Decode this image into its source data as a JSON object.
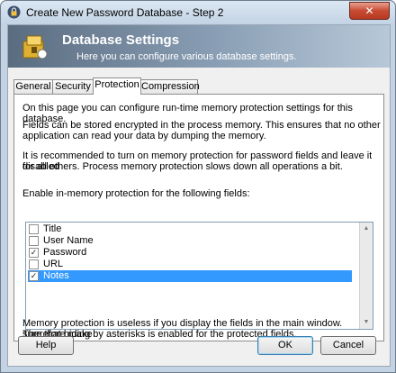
{
  "window": {
    "title": "Create New Password Database - Step 2",
    "close_symbol": "✕"
  },
  "banner": {
    "title": "Database Settings",
    "subtitle": "Here you can configure various database settings."
  },
  "tabs": [
    {
      "label": "General",
      "active": false
    },
    {
      "label": "Security",
      "active": false
    },
    {
      "label": "Protection",
      "active": true
    },
    {
      "label": "Compression",
      "active": false
    }
  ],
  "protection": {
    "intro": "On this page you can configure run-time memory protection settings for this database.",
    "encrypt_line1": "Fields can be stored encrypted in the process memory. This ensures that no other",
    "encrypt_line2": "application can read your data by dumping the memory.",
    "recommend_line1": "It is recommended to turn on memory protection for password fields and leave it disabled",
    "recommend_line2": "for all others. Process memory protection slows down all operations a bit.",
    "list_label": "Enable in-memory protection for the following fields:",
    "fields": [
      {
        "label": "Title",
        "checked": false,
        "mark": "",
        "selected": false
      },
      {
        "label": "User Name",
        "checked": false,
        "mark": "",
        "selected": false
      },
      {
        "label": "Password",
        "checked": true,
        "mark": "✓",
        "selected": false
      },
      {
        "label": "URL",
        "checked": false,
        "mark": "",
        "selected": false
      },
      {
        "label": "Notes",
        "checked": true,
        "mark": "✓",
        "selected": true
      }
    ],
    "footer_line1": "Memory protection is useless if you display the fields in the main window. Therefore make",
    "footer_line2": "sure that hiding by asterisks is enabled for the protected fields."
  },
  "buttons": {
    "help": "Help",
    "ok": "OK",
    "cancel": "Cancel"
  },
  "icons": {
    "title_icon": "lock-icon",
    "banner_icon": "database-icon"
  },
  "colors": {
    "selection": "#3399ff",
    "banner_start": "#5a6c80",
    "close_button": "#c84a33"
  }
}
